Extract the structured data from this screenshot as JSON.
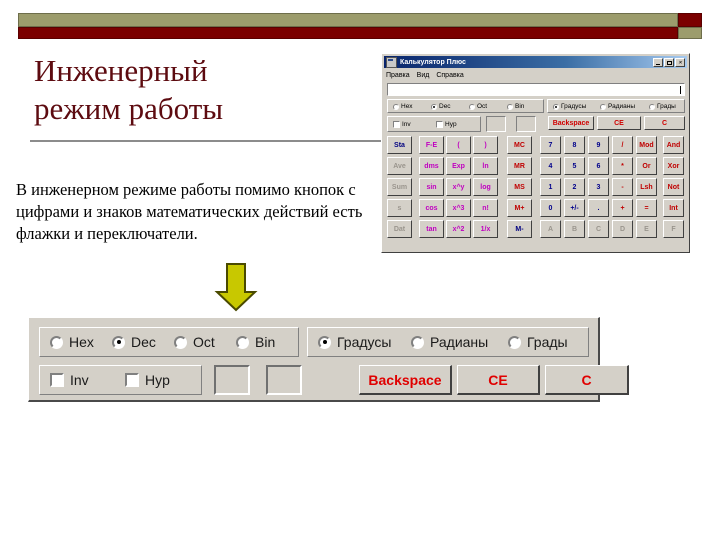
{
  "slide": {
    "title": "Инженерный\nрежим работы",
    "title_line1": "Инженерный",
    "title_line2": "режим работы",
    "body": "В инженерном режиме работы помимо кнопок с цифрами и знаков математических действий есть флажки и переключатели.",
    "accent_color": "#5d0b10",
    "banner_olive": "#9c9c6c",
    "banner_red": "#7b0000",
    "arrow_color": "#c8c800"
  },
  "calculator": {
    "title": "Калькулятор Плюс",
    "menu": [
      "Правка",
      "Вид",
      "Справка"
    ],
    "display_value": "",
    "window_buttons": [
      "minimize-button",
      "maximize-button",
      "close-button"
    ],
    "number_base": {
      "options": [
        "Hex",
        "Dec",
        "Oct",
        "Bin"
      ],
      "selected": "Dec"
    },
    "angle_units": {
      "options": [
        "Градусы",
        "Радианы",
        "Грады"
      ],
      "selected": "Градусы"
    },
    "modifiers": [
      {
        "label": "Inv",
        "checked": false
      },
      {
        "label": "Hyp",
        "checked": false
      }
    ],
    "edit_buttons": [
      "Backspace",
      "CE",
      "C"
    ],
    "keypad": {
      "col_stat": [
        "Sta",
        "Ave",
        "Sum",
        "s",
        "Dat"
      ],
      "col_func1": [
        "F-E",
        "dms",
        "sin",
        "cos",
        "tan"
      ],
      "col_func2": [
        "(",
        "Exp",
        "x^y",
        "x^3",
        "x^2"
      ],
      "col_func3": [
        ")",
        "ln",
        "log",
        "n!",
        "1/x"
      ],
      "col_mem": [
        "MC",
        "MR",
        "MS",
        "M+",
        "M-"
      ],
      "row1": [
        "7",
        "8",
        "9",
        "/",
        "Mod",
        "And"
      ],
      "row2": [
        "4",
        "5",
        "6",
        "*",
        "Or",
        "Xor"
      ],
      "row3": [
        "1",
        "2",
        "3",
        "-",
        "Lsh",
        "Not"
      ],
      "row4": [
        "0",
        "+/-",
        ".",
        "+",
        "=",
        "Int"
      ],
      "row5": [
        "A",
        "B",
        "C",
        "D",
        "E",
        "F"
      ]
    }
  },
  "zoom_panel": {
    "number_base": {
      "options": [
        "Hex",
        "Dec",
        "Oct",
        "Bin"
      ],
      "selected": "Dec"
    },
    "angle_units": {
      "options": [
        "Градусы",
        "Радианы",
        "Грады"
      ],
      "selected": "Градусы"
    },
    "modifiers": [
      {
        "label": "Inv",
        "checked": false
      },
      {
        "label": "Hyp",
        "checked": false
      }
    ],
    "indicator_boxes": [
      "",
      ""
    ],
    "buttons": [
      {
        "label": "Backspace",
        "color": "#e00000"
      },
      {
        "label": "CE",
        "color": "#e00000"
      },
      {
        "label": "C",
        "color": "#e00000"
      }
    ]
  }
}
